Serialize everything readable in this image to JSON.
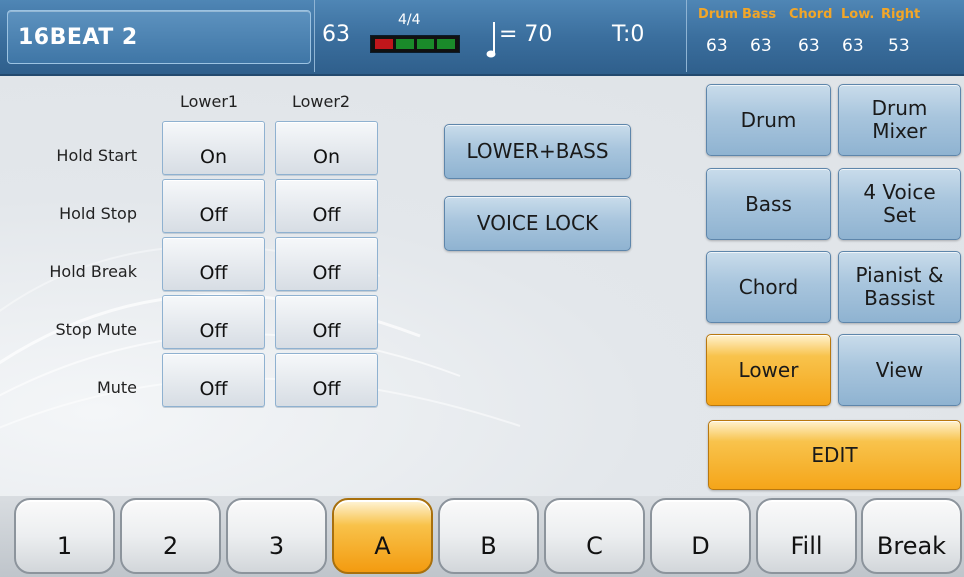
{
  "header": {
    "style_name": "16BEAT 2",
    "value": "63",
    "time_signature": "4/4",
    "beats": [
      "on",
      "off",
      "off",
      "off"
    ],
    "tempo": "= 70",
    "transpose": "T:0",
    "volumes": [
      {
        "name": "Drum",
        "value": "63"
      },
      {
        "name": "Bass",
        "value": "63"
      },
      {
        "name": "Chord",
        "value": "63"
      },
      {
        "name": "Low.",
        "value": "63"
      },
      {
        "name": "Right",
        "value": "53"
      }
    ],
    "colors": {
      "header_bg": "#3b6f9e",
      "volume_label": "#f2a628",
      "beat_on": "#c0161b",
      "beat_off": "#1a8a2a"
    }
  },
  "grid": {
    "columns": [
      "Lower1",
      "Lower2"
    ],
    "rows": [
      {
        "label": "Hold Start",
        "values": [
          "On",
          "On"
        ]
      },
      {
        "label": "Hold Stop",
        "values": [
          "Off",
          "Off"
        ]
      },
      {
        "label": "Hold Break",
        "values": [
          "Off",
          "Off"
        ]
      },
      {
        "label": "Stop Mute",
        "values": [
          "Off",
          "Off"
        ]
      },
      {
        "label": "Mute",
        "values": [
          "Off",
          "Off"
        ]
      }
    ]
  },
  "center_buttons": {
    "lower_bass": "LOWER+BASS",
    "voice_lock": "VOICE LOCK"
  },
  "right_panel": {
    "drum": "Drum",
    "drum_mixer": [
      "Drum",
      "Mixer"
    ],
    "bass": "Bass",
    "four_voice_set": [
      "4 Voice",
      "Set"
    ],
    "chord": "Chord",
    "pianist_bassist": [
      "Pianist &",
      "Bassist"
    ],
    "lower": "Lower",
    "view": "View",
    "edit": "EDIT",
    "active": "Lower"
  },
  "variations": {
    "buttons": [
      "1",
      "2",
      "3",
      "A",
      "B",
      "C",
      "D",
      "Fill",
      "Break"
    ],
    "active": "A",
    "colors": {
      "active": "#f5a519",
      "inactive": "#eceef0"
    }
  }
}
